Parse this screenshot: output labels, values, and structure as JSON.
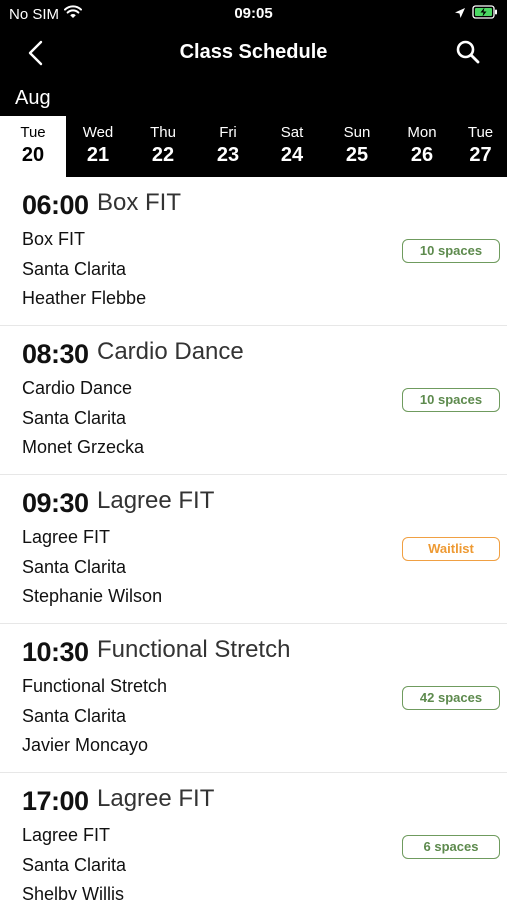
{
  "status_bar": {
    "carrier": "No SIM",
    "time": "09:05"
  },
  "nav": {
    "title": "Class Schedule",
    "back_icon": "chevron-left-icon",
    "search_icon": "search-icon"
  },
  "month": "Aug",
  "days": [
    {
      "name": "Tue",
      "num": "20",
      "selected": true
    },
    {
      "name": "Wed",
      "num": "21",
      "selected": false
    },
    {
      "name": "Thu",
      "num": "22",
      "selected": false
    },
    {
      "name": "Fri",
      "num": "23",
      "selected": false
    },
    {
      "name": "Sat",
      "num": "24",
      "selected": false
    },
    {
      "name": "Sun",
      "num": "25",
      "selected": false
    },
    {
      "name": "Mon",
      "num": "26",
      "selected": false
    },
    {
      "name": "Tue",
      "num": "27",
      "selected": false
    }
  ],
  "classes": [
    {
      "time": "06:00",
      "name": "Box FIT",
      "class_type": "Box FIT",
      "location": "Santa Clarita",
      "instructor": "Heather Flebbe",
      "availability": "10 spaces",
      "status": "available"
    },
    {
      "time": "08:30",
      "name": "Cardio Dance",
      "class_type": "Cardio Dance",
      "location": "Santa Clarita",
      "instructor": "Monet Grzecka",
      "availability": "10 spaces",
      "status": "available"
    },
    {
      "time": "09:30",
      "name": "Lagree FIT",
      "class_type": "Lagree FIT",
      "location": "Santa Clarita",
      "instructor": "Stephanie Wilson",
      "availability": "Waitlist",
      "status": "waitlist"
    },
    {
      "time": "10:30",
      "name": "Functional Stretch",
      "class_type": "Functional Stretch",
      "location": "Santa Clarita",
      "instructor": "Javier Moncayo",
      "availability": "42 spaces",
      "status": "available"
    },
    {
      "time": "17:00",
      "name": "Lagree FIT",
      "class_type": "Lagree FIT",
      "location": "Santa Clarita",
      "instructor": "Shelby Willis",
      "availability": "6 spaces",
      "status": "available"
    }
  ],
  "colors": {
    "header_bg": "#000000",
    "available": "#5d8a4d",
    "waitlist": "#ee9a33"
  }
}
